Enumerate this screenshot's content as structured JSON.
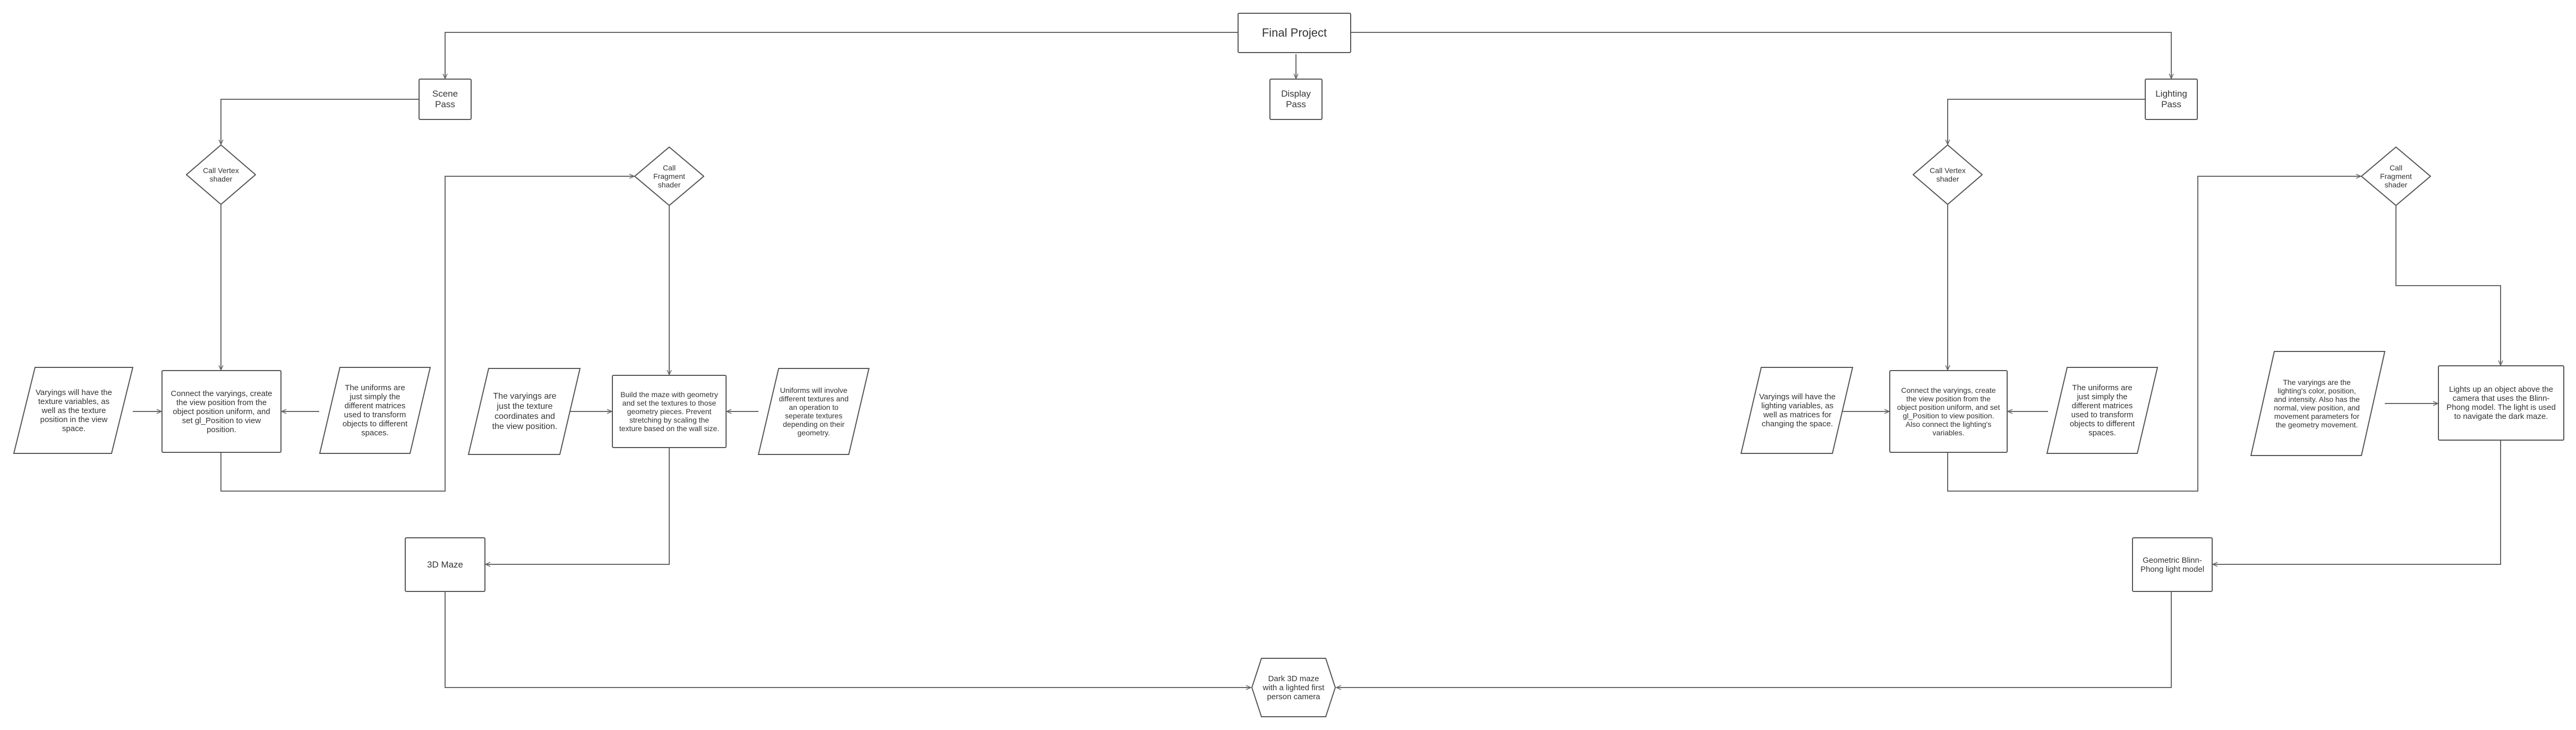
{
  "nodes": {
    "final_project": "Final Project",
    "scene_pass": "Scene Pass",
    "display_pass": "Display Pass",
    "lighting_pass": "Lighting Pass",
    "scene_vertex_call": "Call Vertex shader",
    "scene_fragment_call": "Call Fragment shader",
    "lighting_vertex_call": "Call Vertex shader",
    "lighting_fragment_call": "Call Fragment shader",
    "scene_vertex_varyings": "Varyings will have the texture variables, as well as the texture position in the view space.",
    "scene_vertex_process": "Connect the varyings, create the view position from the object position uniform, and set gl_Position to view position.",
    "scene_vertex_uniforms": "The uniforms are just simply the different matrices used to transform objects to different spaces.",
    "scene_fragment_varyings": "The varyings are just the texture coordinates and the view position.",
    "scene_fragment_process": "Build the maze with geometry and set the textures to those geometry pieces. Prevent stretching by scaling the texture based on the wall size.",
    "scene_fragment_uniforms": "Uniforms will involve different textures and an operation to seperate textures depending on their geometry.",
    "maze_3d": "3D Maze",
    "lighting_vertex_varyings": "Varyings will have the lighting variables, as well as matrices for changing the space.",
    "lighting_vertex_process": "Connect the varyings, create the view position from the object position uniform, and set gl_Position to view position. Also connect the lighting's variables.",
    "lighting_vertex_uniforms": "The uniforms are just simply the different matrices used to transform objects to different spaces.",
    "lighting_fragment_varyings": "The varyings are the lighting's color, position, and intensity. Also has the normal, view position, and movement parameters for the geometry movement.",
    "lighting_fragment_process": "Lights up an object above the camera that uses the Blinn-Phong model. The light is used to navigate the dark maze.",
    "blinn_phong": "Geometric Blinn-Phong light model",
    "result": "Dark 3D maze with a lighted first person camera"
  }
}
